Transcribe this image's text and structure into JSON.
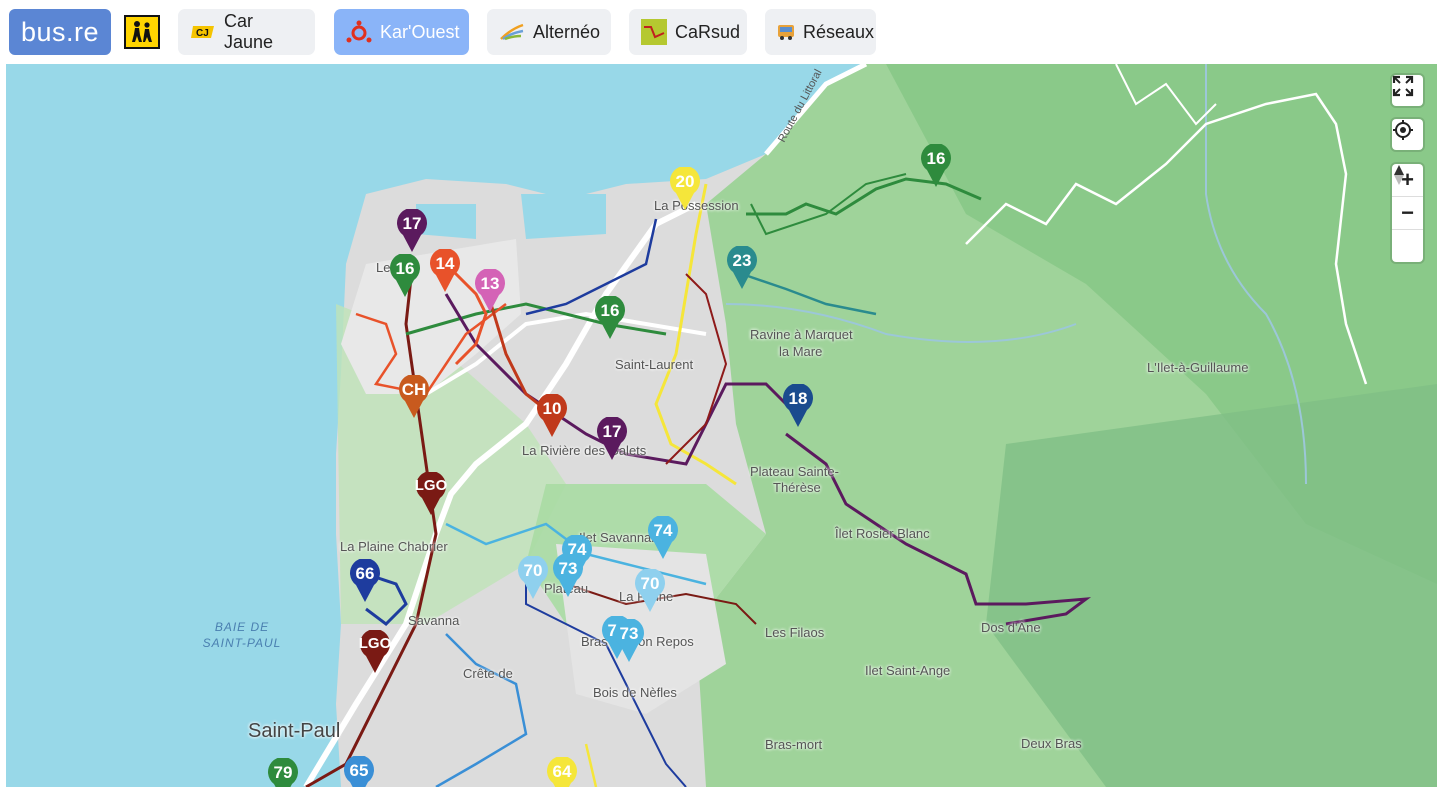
{
  "header": {
    "logo": "bus.re",
    "tabs": [
      {
        "label": "Car Jaune",
        "icon": "car-jaune-logo-icon",
        "active": false
      },
      {
        "label": "Kar'Ouest",
        "icon": "karouest-logo-icon",
        "active": true
      },
      {
        "label": "Alternéo",
        "icon": "alterneo-logo-icon",
        "active": false
      },
      {
        "label": "CaRsud",
        "icon": "carsud-logo-icon",
        "active": false
      },
      {
        "label": "Réseaux",
        "icon": "bus-icon",
        "active": false
      }
    ]
  },
  "map": {
    "places": {
      "la_possession": "La Possession",
      "route_littoral": "Route du Littoral",
      "le_port": "Le",
      "saint_laurent": "Saint-Laurent",
      "ravine_marquet": "Ravine à Marquet",
      "la_mare": "la Mare",
      "ilet_guillaume": "L'Ilet-à-Guillaume",
      "riviere_galets": "La Rivière des Galets",
      "plateau_sainte": "Plateau Sainte-",
      "therese": "Thérèse",
      "ilet_rosier": "Îlet Rosier Blanc",
      "ilet_savannah": "Ilet Savannah",
      "plaine_chabrier": "La Plaine Chabrier",
      "savanna": "Savanna",
      "baie_1": "BAIE DE",
      "baie_2": "SAINT-PAUL",
      "dos_ane": "Dos d'Âne",
      "les_filaos": "Les Filaos",
      "ilet_saint_ange": "Ilet Saint-Ange",
      "la_plaine": "La Plaine",
      "bras_repos": "Bras de Bon Repos",
      "crete": "Crête de",
      "bois_nefles": "Bois de Nèfles",
      "saint_paul": "Saint-Paul",
      "bras_mort": "Bras-mort",
      "deux_bras": "Deux Bras",
      "plateau_caillou": "Plateau"
    },
    "markers": [
      {
        "label": "16",
        "color": "#2e8b3d"
      },
      {
        "label": "20",
        "color": "#f5e63a"
      },
      {
        "label": "17",
        "color": "#5b1a5e"
      },
      {
        "label": "14",
        "color": "#e8522a"
      },
      {
        "label": "16",
        "color": "#2e8b3d"
      },
      {
        "label": "13",
        "color": "#d463b6"
      },
      {
        "label": "23",
        "color": "#2a8b8e"
      },
      {
        "label": "16",
        "color": "#2e8b3d"
      },
      {
        "label": "CH",
        "color": "#c85a1e"
      },
      {
        "label": "10",
        "color": "#c0391b"
      },
      {
        "label": "18",
        "color": "#1a4b8e"
      },
      {
        "label": "17",
        "color": "#5b1a5e"
      },
      {
        "label": "LGO",
        "color": "#7a1a14"
      },
      {
        "label": "74",
        "color": "#4bb3e0"
      },
      {
        "label": "74",
        "color": "#4bb3e0"
      },
      {
        "label": "70",
        "color": "#8fd0ee"
      },
      {
        "label": "73",
        "color": "#4bb3e0"
      },
      {
        "label": "70",
        "color": "#8fd0ee"
      },
      {
        "label": "66",
        "color": "#1e3c9e"
      },
      {
        "label": "73",
        "color": "#4bb3e0"
      },
      {
        "label": "73",
        "color": "#4bb3e0"
      },
      {
        "label": "LGO",
        "color": "#7a1a14"
      },
      {
        "label": "79",
        "color": "#2e8b3d"
      },
      {
        "label": "65",
        "color": "#3a8fd6"
      },
      {
        "label": "64",
        "color": "#f5e63a"
      }
    ]
  },
  "controls": {
    "fullscreen": "fullscreen-icon",
    "locate": "locate-icon",
    "zoom_in": "+",
    "zoom_out": "−",
    "compass": "compass-icon"
  }
}
